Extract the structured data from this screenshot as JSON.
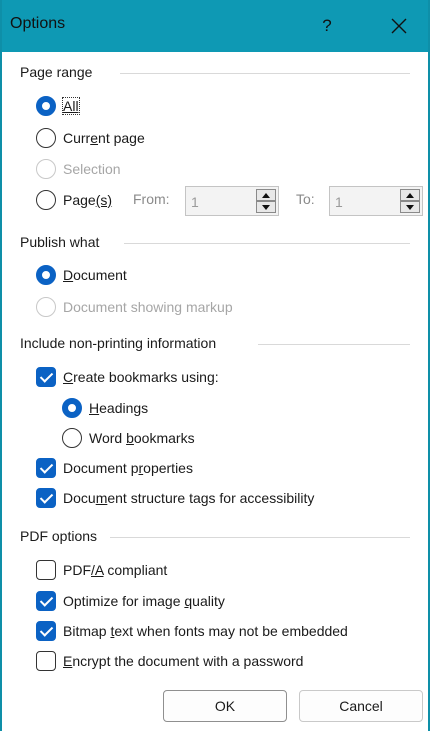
{
  "window": {
    "title": "Options",
    "help_label": "?"
  },
  "page_range": {
    "heading": "Page range",
    "all_label": "All",
    "current_label_a": "Curr",
    "current_label_u": "e",
    "current_label_b": "nt page",
    "selection_label": "Selection",
    "pages_label_a": "Page",
    "pages_label_u": "(s)",
    "from_label": "From:",
    "from_value": "1",
    "to_label": "To:",
    "to_value": "1",
    "selected": "All"
  },
  "publish_what": {
    "heading": "Publish what",
    "document_label_u": "D",
    "document_label_b": "ocument",
    "markup_label": "Document showing markup",
    "selected": "Document"
  },
  "non_printing": {
    "heading": "Include non-printing information",
    "bookmarks_label_u": "C",
    "bookmarks_label_b": "reate bookmarks using:",
    "bookmarks_checked": true,
    "headings_label_u": "H",
    "headings_label_b": "eadings",
    "word_bookmarks_label_a": "Word ",
    "word_bookmarks_label_u": "b",
    "word_bookmarks_label_b": "ookmarks",
    "bookmark_source": "Headings",
    "doc_props_label_a": "Document p",
    "doc_props_label_u": "r",
    "doc_props_label_b": "operties",
    "doc_props_checked": true,
    "struct_tags_label_a": "Docu",
    "struct_tags_label_u": "m",
    "struct_tags_label_b": "ent structure tags for accessibility",
    "struct_tags_checked": true
  },
  "pdf_options": {
    "heading": "PDF options",
    "pdfa_label_a": "PDF",
    "pdfa_label_u": "/A",
    "pdfa_label_b": " compliant",
    "pdfa_checked": false,
    "optimize_label_a": "Optimize for image ",
    "optimize_label_u": "q",
    "optimize_label_b": "uality",
    "optimize_checked": true,
    "bitmap_label_a": "Bitmap ",
    "bitmap_label_u": "t",
    "bitmap_label_b": "ext when fonts may not be embedded",
    "bitmap_checked": true,
    "encrypt_label_u": "E",
    "encrypt_label_b": "ncrypt the document with a password",
    "encrypt_checked": false
  },
  "buttons": {
    "ok": "OK",
    "cancel": "Cancel"
  },
  "colors": {
    "titlebar": "#0e99b4",
    "accent": "#0b62c4"
  }
}
